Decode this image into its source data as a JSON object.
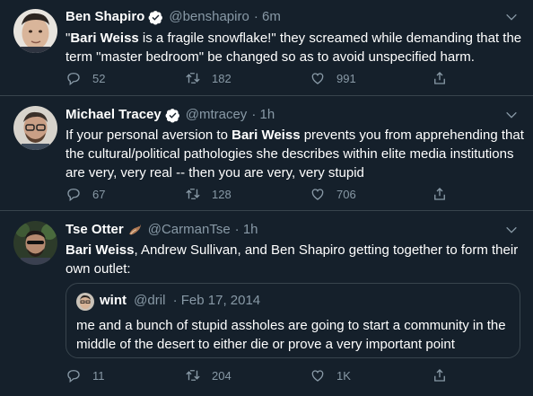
{
  "tweets": [
    {
      "name": "Ben Shapiro",
      "handle": "@benshapiro",
      "time": "· 6m",
      "text_parts": [
        "\"",
        "Bari Weiss",
        " is a fragile snowflake!\" they screamed while demanding that the term \"master bedroom\" be changed so as to avoid unspecified harm."
      ],
      "replies": "52",
      "retweets": "182",
      "likes": "991"
    },
    {
      "name": "Michael Tracey",
      "handle": "@mtracey",
      "time": "· 1h",
      "text_parts": [
        "If your personal aversion to ",
        "Bari Weiss",
        " prevents you from apprehending that the cultural/political pathologies she describes within elite media institutions are very, very real -- then you are very, very stupid"
      ],
      "replies": "67",
      "retweets": "128",
      "likes": "706"
    },
    {
      "name": "Tse Otter",
      "handle": "@CarmanTse",
      "time": "· 1h",
      "text_parts": [
        "",
        "Bari Weiss",
        ", Andrew Sullivan, and Ben Shapiro getting together to form their own outlet:"
      ],
      "quote": {
        "name": "wint",
        "handle": "@dril",
        "time": "· Feb 17, 2014",
        "text": "me and a bunch of stupid assholes are going to start a community in the middle of the desert to either die or prove a very important point"
      },
      "replies": "11",
      "retweets": "204",
      "likes": "1K"
    }
  ],
  "colors": {
    "background": "#15202b",
    "border": "#38444d",
    "secondary_text": "#8899a6",
    "verified": "#ffffff"
  },
  "icons": [
    "verified-badge-icon",
    "chevron-down-icon",
    "reply-icon",
    "retweet-icon",
    "like-icon",
    "share-icon"
  ]
}
